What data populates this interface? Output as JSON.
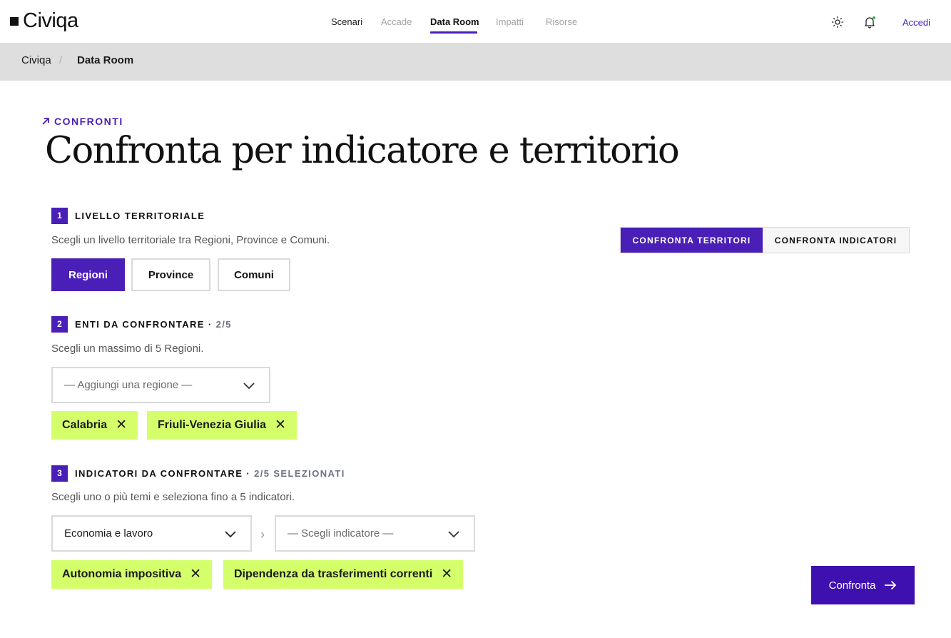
{
  "brand": {
    "logo_text": "Civiqa",
    "accent": "#4a1fb8",
    "chip_color": "#d4ff6b"
  },
  "nav": {
    "items": [
      {
        "label": "Scenari",
        "state": "normal"
      },
      {
        "label": "Accade",
        "state": "muted"
      },
      {
        "label": "Data Room",
        "state": "active"
      },
      {
        "label": "Impatti",
        "state": "muted"
      },
      {
        "label": "Risorse",
        "state": "muted"
      }
    ],
    "icons": [
      "sun-icon",
      "bell-icon"
    ],
    "login_label": "Accedi"
  },
  "breadcrumb": {
    "root": "Civiqa",
    "separator": "/",
    "current": "Data Room"
  },
  "header": {
    "eyebrow": "CONFRONTI",
    "title": "Confronta per indicatore e territorio"
  },
  "mode_toggle": {
    "territori": "CONFRONTA TERRITORI",
    "indicatori": "CONFRONTA INDICATORI",
    "selected": "territori"
  },
  "step1": {
    "number": "1",
    "title": "LIVELLO TERRITORIALE",
    "description": "Scegli un livello territoriale tra Regioni, Province e Comuni.",
    "options": [
      "Regioni",
      "Province",
      "Comuni"
    ],
    "selected": "Regioni"
  },
  "step2": {
    "number": "2",
    "title": "ENTI DA CONFRONTARE",
    "count": "2/5",
    "description": "Scegli un massimo di 5 Regioni.",
    "select_placeholder": "— Aggiungi una regione —",
    "chips": [
      "Calabria",
      "Friuli-Venezia Giulia"
    ]
  },
  "step3": {
    "number": "3",
    "title": "INDICATORI DA CONFRONTARE",
    "count": "2/5 SELEZIONATI",
    "description": "Scegli uno o più temi e seleziona fino a 5 indicatori.",
    "theme_value": "Economia e lavoro",
    "separator": "›",
    "indicator_placeholder": "— Scegli indicatore —",
    "chips": [
      "Autonomia impositiva",
      "Dipendenza da trasferimenti correnti"
    ]
  },
  "cta": {
    "label": "Confronta"
  },
  "chip_remove": "✕",
  "dot_separator": "·"
}
